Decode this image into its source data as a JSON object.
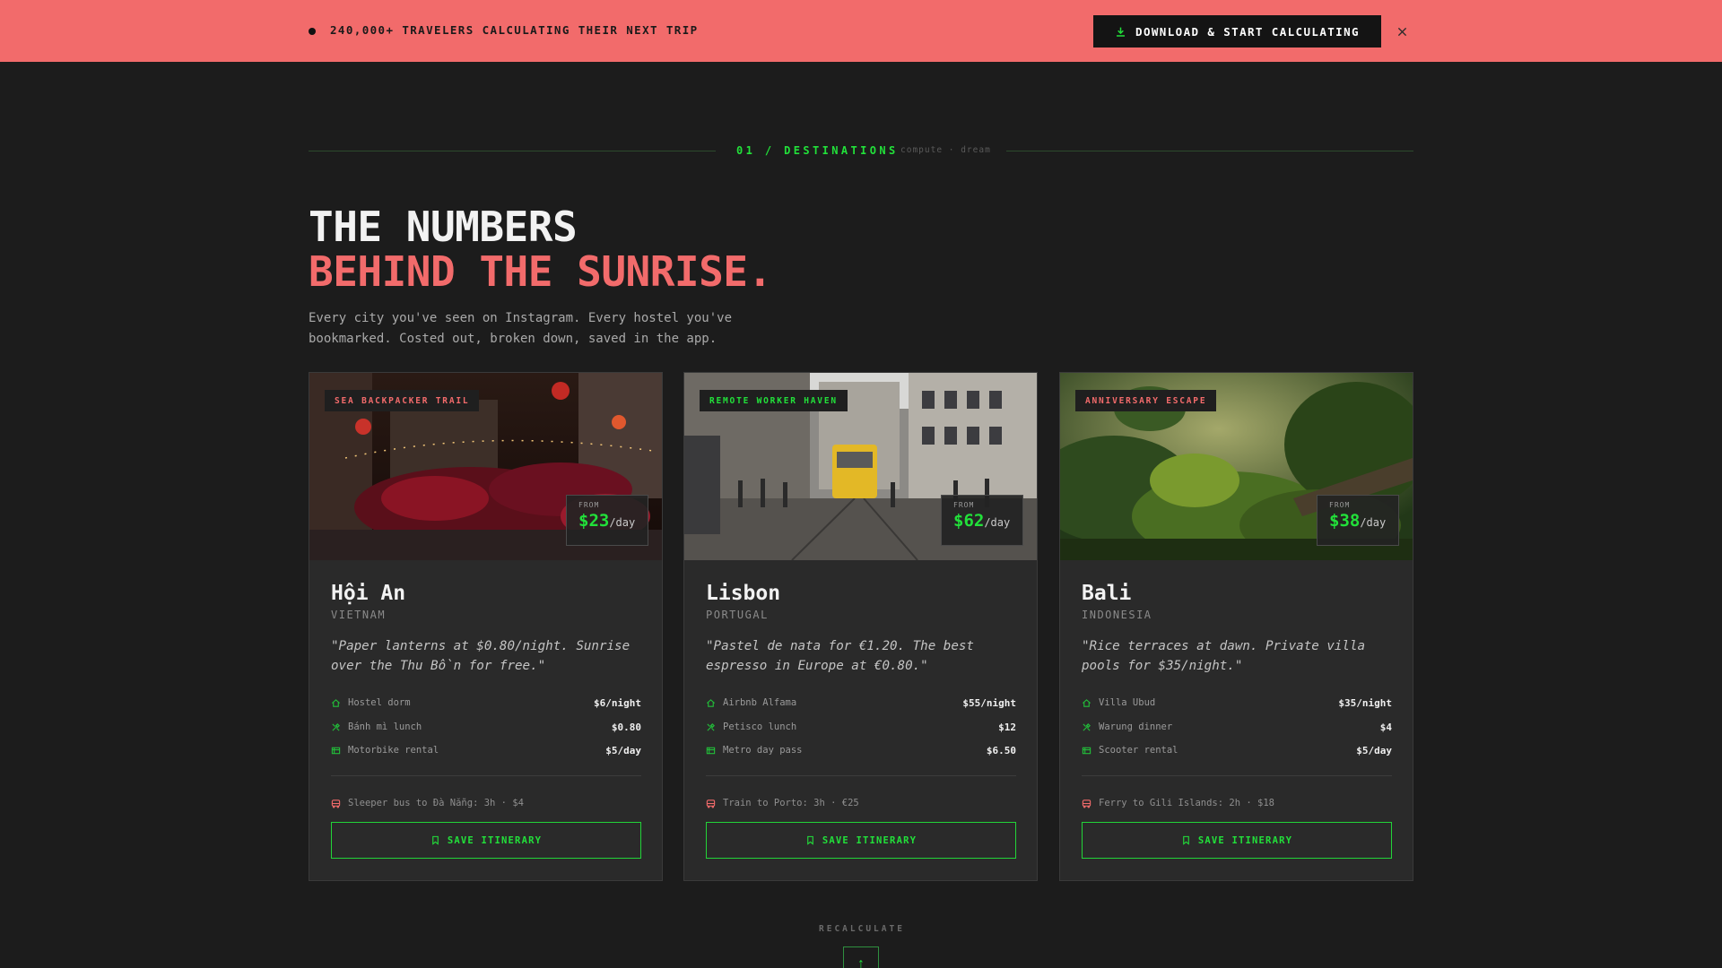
{
  "banner": {
    "text": "240,000+ TRAVELERS CALCULATING THEIR NEXT TRIP",
    "cta_label": "DOWNLOAD & START CALCULATING",
    "cta_icon": "download-icon",
    "close_icon": "close-icon"
  },
  "section": {
    "label": "01 / DESTINATIONS",
    "sub": "compute · dream"
  },
  "headline": {
    "line1": "THE NUMBERS",
    "line2": "BEHIND THE SUNRISE."
  },
  "intro": "Every city you've seen on Instagram. Every hostel you've bookmarked. Costed out, broken down, saved in the app.",
  "colors": {
    "banner": "#f26b6b",
    "accent_green": "#22e03a",
    "accent_coral": "#f26b6b",
    "background": "#1c1c1c",
    "card": "#2a2a2a"
  },
  "cards": [
    {
      "tag": "SEA BACKPACKER TRAIL",
      "tag_color": "#f26b6b",
      "price_from": "FROM",
      "price": "$23",
      "price_unit": "/day",
      "name": "Hội An",
      "country": "VIETNAM",
      "quote": "\"Paper lanterns at $0.80/night. Sunrise over the Thu Bồn for free.\"",
      "costs": [
        {
          "icon": "home-icon",
          "label": "Hostel dorm",
          "value": "$6/night"
        },
        {
          "icon": "utensils-icon",
          "label": "Bánh mì lunch",
          "value": "$0.80"
        },
        {
          "icon": "ticket-icon",
          "label": "Motorbike rental",
          "value": "$5/day"
        }
      ],
      "transport_icon": "bus-icon",
      "transport": "Sleeper bus to Đà Nẵng: 3h · $4",
      "save_label": "SAVE ITINERARY"
    },
    {
      "tag": "REMOTE WORKER HAVEN",
      "tag_color": "#22e03a",
      "price_from": "FROM",
      "price": "$62",
      "price_unit": "/day",
      "name": "Lisbon",
      "country": "PORTUGAL",
      "quote": "\"Pastel de nata for €1.20. The best espresso in Europe at €0.80.\"",
      "costs": [
        {
          "icon": "home-icon",
          "label": "Airbnb Alfama",
          "value": "$55/night"
        },
        {
          "icon": "utensils-icon",
          "label": "Petisco lunch",
          "value": "$12"
        },
        {
          "icon": "ticket-icon",
          "label": "Metro day pass",
          "value": "$6.50"
        }
      ],
      "transport_icon": "bus-icon",
      "transport": "Train to Porto: 3h · €25",
      "save_label": "SAVE ITINERARY"
    },
    {
      "tag": "ANNIVERSARY ESCAPE",
      "tag_color": "#f26b6b",
      "price_from": "FROM",
      "price": "$38",
      "price_unit": "/day",
      "name": "Bali",
      "country": "INDONESIA",
      "quote": "\"Rice terraces at dawn. Private villa pools for $35/night.\"",
      "costs": [
        {
          "icon": "home-icon",
          "label": "Villa Ubud",
          "value": "$35/night"
        },
        {
          "icon": "utensils-icon",
          "label": "Warung dinner",
          "value": "$4"
        },
        {
          "icon": "ticket-icon",
          "label": "Scooter rental",
          "value": "$5/day"
        }
      ],
      "transport_icon": "bus-icon",
      "transport": "Ferry to Gili Islands: 2h · $18",
      "save_label": "SAVE ITINERARY"
    }
  ],
  "footer": {
    "recalc_label": "RECALCULATE",
    "recalc_arrow": "↑"
  }
}
